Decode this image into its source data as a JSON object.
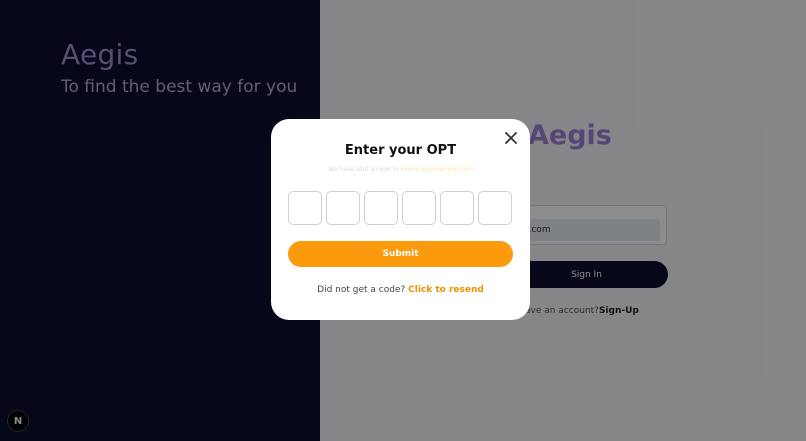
{
  "hero": {
    "brand": "Aegis",
    "tagline": "To find the best way for you"
  },
  "badge": {
    "letter": "N",
    "icon": "nextjs-logo-icon"
  },
  "login": {
    "brand": "Aegis",
    "email_value": "l.com",
    "signin_label": "Sign In",
    "signup_prompt": "ave an account?",
    "signup_link": "Sign-Up"
  },
  "modal": {
    "title": "Enter your OPT",
    "sent_text": "We have sent a code to",
    "sent_email": "example@example.com",
    "otp_digits": [
      "",
      "",
      "",
      "",
      "",
      ""
    ],
    "submit_label": "Submit",
    "resend_prompt": "Did not get a code?",
    "resend_link": "Click to resend",
    "close_icon": "close-icon"
  },
  "colors": {
    "left_panel": "#0b1030",
    "accent_orange": "#fa9a0c",
    "brand_purple": "#a07fd9"
  }
}
